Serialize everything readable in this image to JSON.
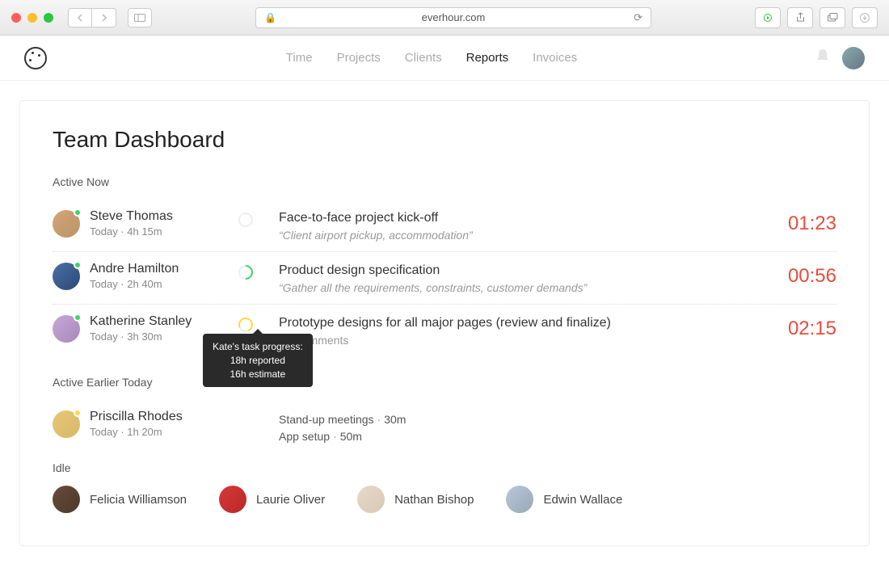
{
  "browser": {
    "url": "everhour.com"
  },
  "nav": {
    "items": [
      "Time",
      "Projects",
      "Clients",
      "Reports",
      "Invoices"
    ],
    "active_index": 3
  },
  "page": {
    "title": "Team Dashboard"
  },
  "sections": {
    "active_now": {
      "label": "Active Now",
      "rows": [
        {
          "name": "Steve Thomas",
          "meta": "Today ·  4h 15m",
          "task": "Face-to-face project kick-off",
          "note": "“Client airport pickup, accommodation”",
          "timer": "01:23"
        },
        {
          "name": "Andre Hamilton",
          "meta": "Today ·  2h 40m",
          "task": "Product design specification",
          "note": "“Gather all the requirements, constraints, customer demands”",
          "timer": "00:56"
        },
        {
          "name": "Katherine Stanley",
          "meta": "Today ·  3h 30m",
          "task": "Prototype designs for all major pages (review and finalize)",
          "note": "No comments",
          "timer": "02:15"
        }
      ]
    },
    "active_earlier": {
      "label": "Active Earlier Today",
      "rows": [
        {
          "name": "Priscilla Rhodes",
          "meta": "Today ·  1h 20m",
          "subtasks": [
            {
              "name": "Stand-up meetings",
              "duration": "30m"
            },
            {
              "name": "App setup",
              "duration": "50m"
            }
          ]
        }
      ]
    },
    "idle": {
      "label": "Idle",
      "users": [
        {
          "name": "Felicia Williamson"
        },
        {
          "name": "Laurie Oliver"
        },
        {
          "name": "Nathan Bishop"
        },
        {
          "name": "Edwin Wallace"
        }
      ]
    }
  },
  "tooltip": {
    "line1": "Kate's task progress:",
    "line2": "18h reported",
    "line3": "16h estimate"
  }
}
